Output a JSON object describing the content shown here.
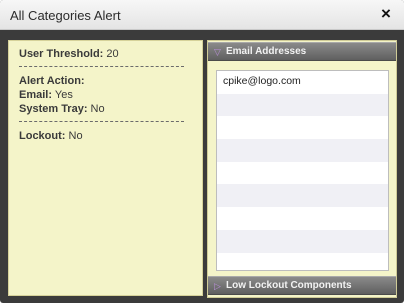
{
  "window": {
    "title": "All Categories Alert",
    "close_icon": "×"
  },
  "left_panel": {
    "user_threshold_label": "User Threshold:",
    "user_threshold_value": "20",
    "alert_action_label": "Alert Action:",
    "email_label": "Email:",
    "email_value": "Yes",
    "system_tray_label": "System Tray:",
    "system_tray_value": "No",
    "lockout_label": "Lockout:",
    "lockout_value": "No"
  },
  "right_panel": {
    "email_section": {
      "label": "Email Addresses",
      "expanded": true,
      "arrow_icon": "▽",
      "rows": [
        "cpike@logo.com",
        "",
        "",
        "",
        "",
        "",
        "",
        "",
        ""
      ]
    },
    "lockout_section": {
      "label": "Low Lockout Components",
      "expanded": false,
      "arrow_icon": "▷"
    }
  },
  "colors": {
    "panel_bg": "#f4f4c9",
    "window_bg": "#3b3b3b",
    "header_bg": "#6e6e6e",
    "arrow": "#b98ed8"
  }
}
